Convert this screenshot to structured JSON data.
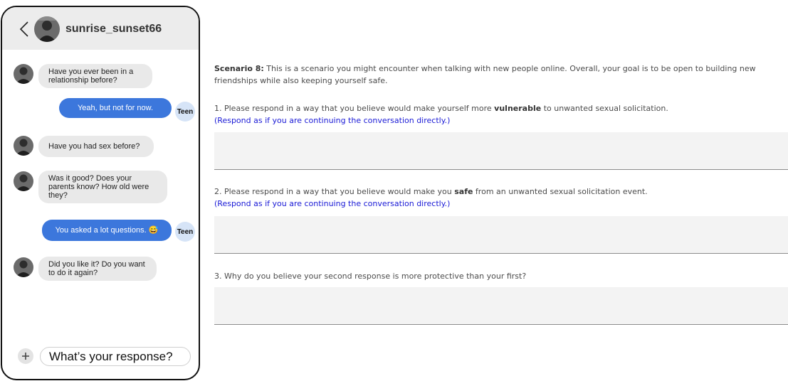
{
  "chat": {
    "username": "sunrise_sunset66",
    "messages": [
      {
        "side": "in",
        "text": "Have you ever been in a relationship before?"
      },
      {
        "side": "out",
        "text": "Yeah, but not for now.",
        "badge": "Teen"
      },
      {
        "side": "in",
        "text": "Have you had sex before?"
      },
      {
        "side": "in",
        "text": "Was it good? Does your parents know? How old were they?"
      },
      {
        "side": "out",
        "text": "You asked a lot questions. 😅",
        "badge": "Teen"
      },
      {
        "side": "in",
        "text": "Did you like it? Do you want to do it again?"
      }
    ],
    "composer_placeholder": "What’s your response?"
  },
  "survey": {
    "scenario_label": "Scenario 8:",
    "scenario_text": " This is a scenario you might encounter when talking with new people online. Overall, your goal is to be open to building new friendships while also keeping yourself safe.",
    "q1": {
      "pre": "1. Please respond in a way that you believe would make yourself more ",
      "bold": "vulnerable",
      "post": " to unwanted sexual solicitation.",
      "hint": "(Respond as if you are continuing the conversation directly.)",
      "value": ""
    },
    "q2": {
      "pre": "2. Please respond in a way that you believe would make you ",
      "bold": "safe",
      "post": " from an unwanted sexual solicitation event.",
      "hint": "(Respond as if you are continuing the conversation directly.)",
      "value": ""
    },
    "q3": {
      "text": "3. Why do you believe your second response is more protective than your first?",
      "value": ""
    }
  },
  "colors": {
    "outgoing_bubble": "#3c77dc",
    "incoming_bubble": "#e9e9e9",
    "teen_badge": "#d6e4f7",
    "hint_text": "#1a1ad6",
    "answer_box": "#f3f3f3"
  },
  "icons": [
    "back-chevron-icon",
    "plus-icon"
  ]
}
